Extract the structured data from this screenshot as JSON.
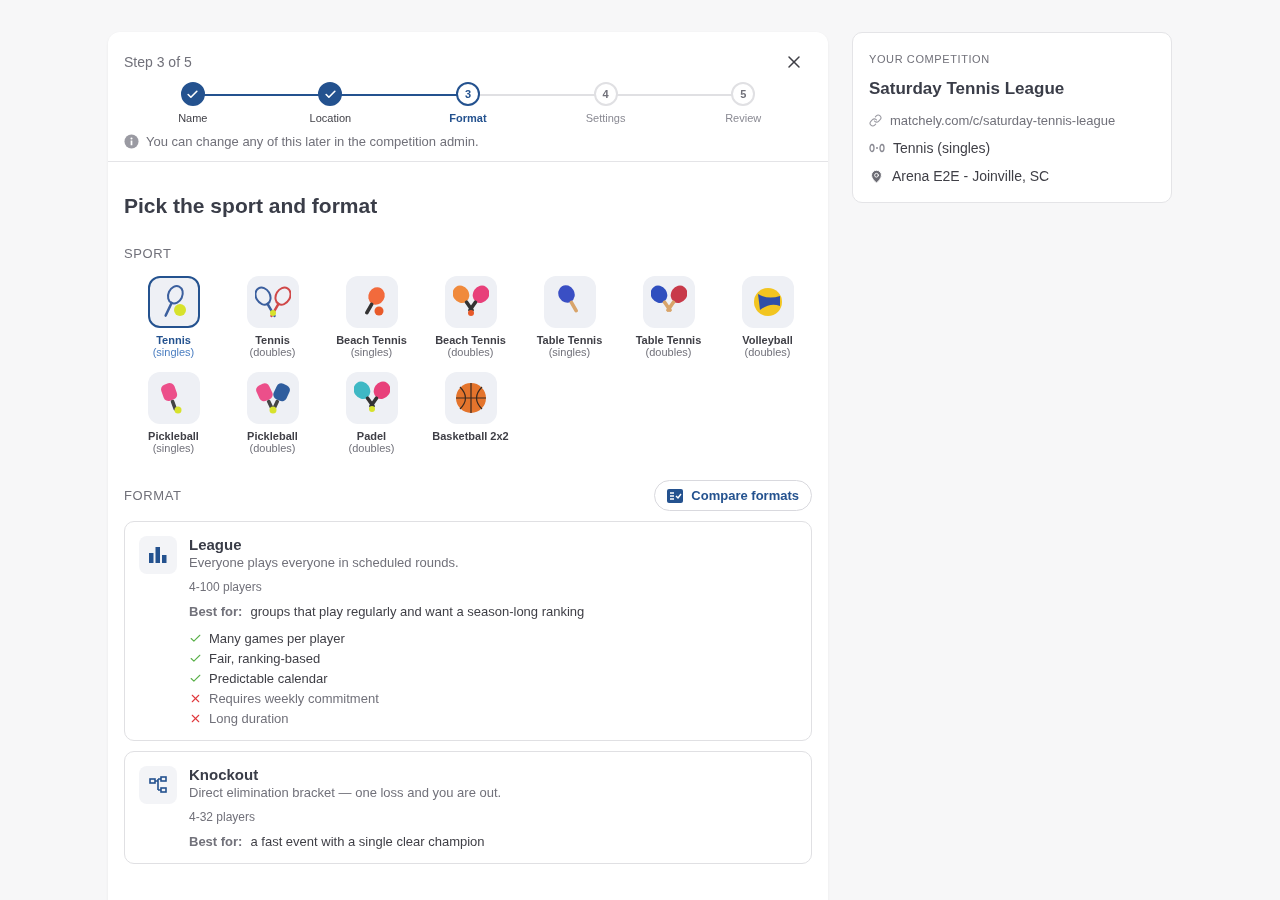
{
  "wizard": {
    "step_label": "Step 3 of 5",
    "steps": [
      {
        "label": "Name",
        "kind": "done"
      },
      {
        "label": "Location",
        "kind": "done"
      },
      {
        "number": "3",
        "label": "Format",
        "kind": "current"
      },
      {
        "number": "4",
        "label": "Settings",
        "kind": "upcoming"
      },
      {
        "number": "5",
        "label": "Review",
        "kind": "upcoming"
      }
    ],
    "hint": "You can change any of this later in the competition admin.",
    "heading": "Pick the sport and format",
    "sport_label": "SPORT",
    "sports": [
      {
        "name": "Tennis",
        "variant": "(singles)",
        "kind": "tennis",
        "selected": true
      },
      {
        "name": "Tennis",
        "variant": "(doubles)",
        "kind": "tennis-pair",
        "selected": false
      },
      {
        "name": "Beach Tennis",
        "variant": "(singles)",
        "kind": "beach",
        "selected": false
      },
      {
        "name": "Beach Tennis",
        "variant": "(doubles)",
        "kind": "beach-pair",
        "selected": false
      },
      {
        "name": "Table Tennis",
        "variant": "(singles)",
        "kind": "pingpong",
        "selected": false
      },
      {
        "name": "Table Tennis",
        "variant": "(doubles)",
        "kind": "pingpong-pair",
        "selected": false
      },
      {
        "name": "Volleyball",
        "variant": "(doubles)",
        "kind": "volleyball",
        "selected": false
      },
      {
        "name": "Pickleball",
        "variant": "(singles)",
        "kind": "pickleball",
        "selected": false
      },
      {
        "name": "Pickleball",
        "variant": "(doubles)",
        "kind": "pickleball-pair",
        "selected": false
      },
      {
        "name": "Padel",
        "variant": "(doubles)",
        "kind": "padel-pair",
        "selected": false
      },
      {
        "name": "Basketball 2x2",
        "kind": "basketball",
        "selected": false
      }
    ],
    "format_label": "FORMAT",
    "compare_button": "Compare formats",
    "formats": [
      {
        "kind": "league",
        "title": "League",
        "description": "Everyone plays everyone in scheduled rounds.",
        "players": "4-100 players",
        "best_for_label": "Best for:",
        "best_for": "groups that play regularly and want a season-long ranking",
        "points": [
          {
            "kind": "pro",
            "text": "Many games per player"
          },
          {
            "kind": "pro",
            "text": "Fair, ranking-based"
          },
          {
            "kind": "pro",
            "text": "Predictable calendar"
          },
          {
            "kind": "con",
            "text": "Requires weekly commitment"
          },
          {
            "kind": "con",
            "text": "Long duration"
          }
        ]
      },
      {
        "kind": "knockout",
        "title": "Knockout",
        "description": "Direct elimination bracket — one loss and you are out.",
        "players": "4-32 players",
        "best_for_label": "Best for:",
        "best_for": "a fast event with a single clear champion"
      }
    ]
  },
  "summary": {
    "label": "YOUR COMPETITION",
    "title": "Saturday Tennis League",
    "url": "matchely.com/c/saturday-tennis-league",
    "sport": "Tennis (singles)",
    "location": "Arena E2E - Joinville, SC"
  }
}
